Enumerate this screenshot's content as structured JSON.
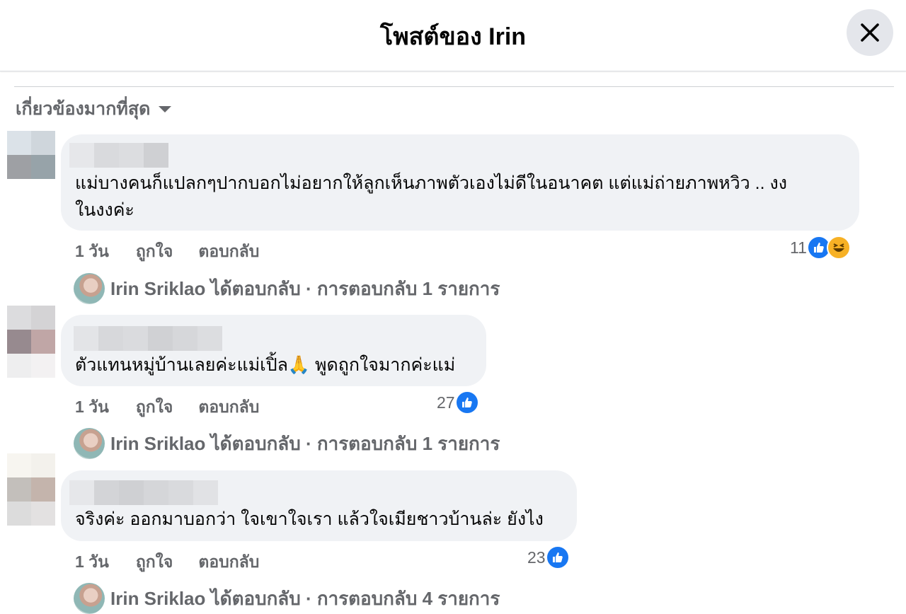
{
  "header": {
    "title": "โพสต์ของ Irin"
  },
  "sort": {
    "label": "เกี่ยวข้องมากที่สุด"
  },
  "comments": [
    {
      "text_lines": [
        "แม่บางคนก็แปลกๆปากบอกไม่อยากให้ลูกเห็นภาพตัวเองไม่ดีในอนาคต แต่แม่ถ่ายภาพหวิว .. งง",
        "ในงงค่ะ"
      ],
      "time": "1 วัน",
      "like_label": "ถูกใจ",
      "reply_label": "ตอบกลับ",
      "reaction_count": "11",
      "reactions": [
        "like-icon",
        "haha-icon"
      ],
      "reply_summary": "Irin Sriklao ได้ตอบกลับ · การตอบกลับ 1 รายการ"
    },
    {
      "text_lines": [
        "ตัวแทนหมู่บ้านเลยค่ะแม่เปิ้ล🙏 พูดถูกใจมากค่ะแม่"
      ],
      "time": "1 วัน",
      "like_label": "ถูกใจ",
      "reply_label": "ตอบกลับ",
      "reaction_count": "27",
      "reactions": [
        "like-icon"
      ],
      "reply_summary": "Irin Sriklao ได้ตอบกลับ · การตอบกลับ 1 รายการ"
    },
    {
      "text_lines": [
        "จริงค่ะ ออกมาบอกว่า ใจเขาใจเรา แล้วใจเมียชาวบ้านล่ะ ยังไง"
      ],
      "time": "1 วัน",
      "like_label": "ถูกใจ",
      "reply_label": "ตอบกลับ",
      "reaction_count": "23",
      "reactions": [
        "like-icon"
      ],
      "reply_summary": "Irin Sriklao ได้ตอบกลับ · การตอบกลับ 4 รายการ"
    }
  ],
  "colors": {
    "like_blue": "#1877f2",
    "bubble_bg": "#f0f2f5",
    "secondary_text": "#65676b"
  }
}
